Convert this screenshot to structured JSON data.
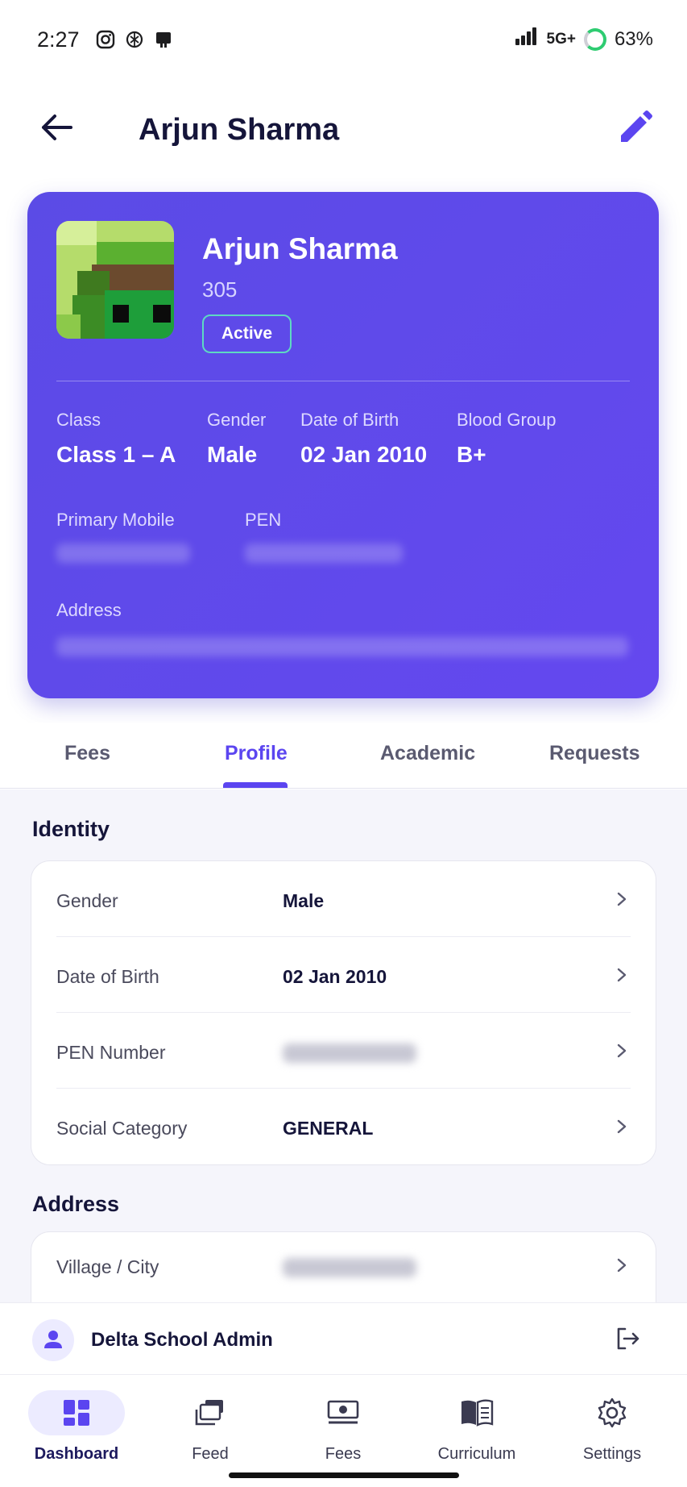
{
  "status_bar": {
    "time": "2:27",
    "network": "5G+",
    "battery": "63%"
  },
  "header": {
    "title": "Arjun Sharma",
    "back_icon": "arrow-left-icon",
    "edit_icon": "pencil-icon"
  },
  "profile_card": {
    "name": "Arjun Sharma",
    "roll": "305",
    "status": "Active",
    "fields": {
      "class_label": "Class",
      "class_value": "Class 1 – A",
      "gender_label": "Gender",
      "gender_value": "Male",
      "dob_label": "Date of Birth",
      "dob_value": "02 Jan 2010",
      "blood_label": "Blood Group",
      "blood_value": "B+",
      "mobile_label": "Primary Mobile",
      "pen_label": "PEN",
      "address_label": "Address"
    }
  },
  "tabs": [
    {
      "label": "Fees"
    },
    {
      "label": "Profile"
    },
    {
      "label": "Academic"
    },
    {
      "label": "Requests"
    }
  ],
  "identity": {
    "title": "Identity",
    "rows": [
      {
        "label": "Gender",
        "value": "Male"
      },
      {
        "label": "Date of Birth",
        "value": "02 Jan 2010"
      },
      {
        "label": "PEN Number",
        "value": ""
      },
      {
        "label": "Social Category",
        "value": "GENERAL"
      }
    ]
  },
  "address": {
    "title": "Address",
    "rows": [
      {
        "label": "Village / City",
        "value": ""
      }
    ]
  },
  "admin": {
    "name": "Delta School Admin"
  },
  "bottom_nav": [
    {
      "label": "Dashboard",
      "icon": "dashboard-icon"
    },
    {
      "label": "Feed",
      "icon": "feed-icon"
    },
    {
      "label": "Fees",
      "icon": "fees-icon"
    },
    {
      "label": "Curriculum",
      "icon": "book-icon"
    },
    {
      "label": "Settings",
      "icon": "gear-icon"
    }
  ],
  "colors": {
    "accent": "#5b45f0",
    "card": "#5b4be6",
    "active_badge_border": "#5ed9c3"
  }
}
